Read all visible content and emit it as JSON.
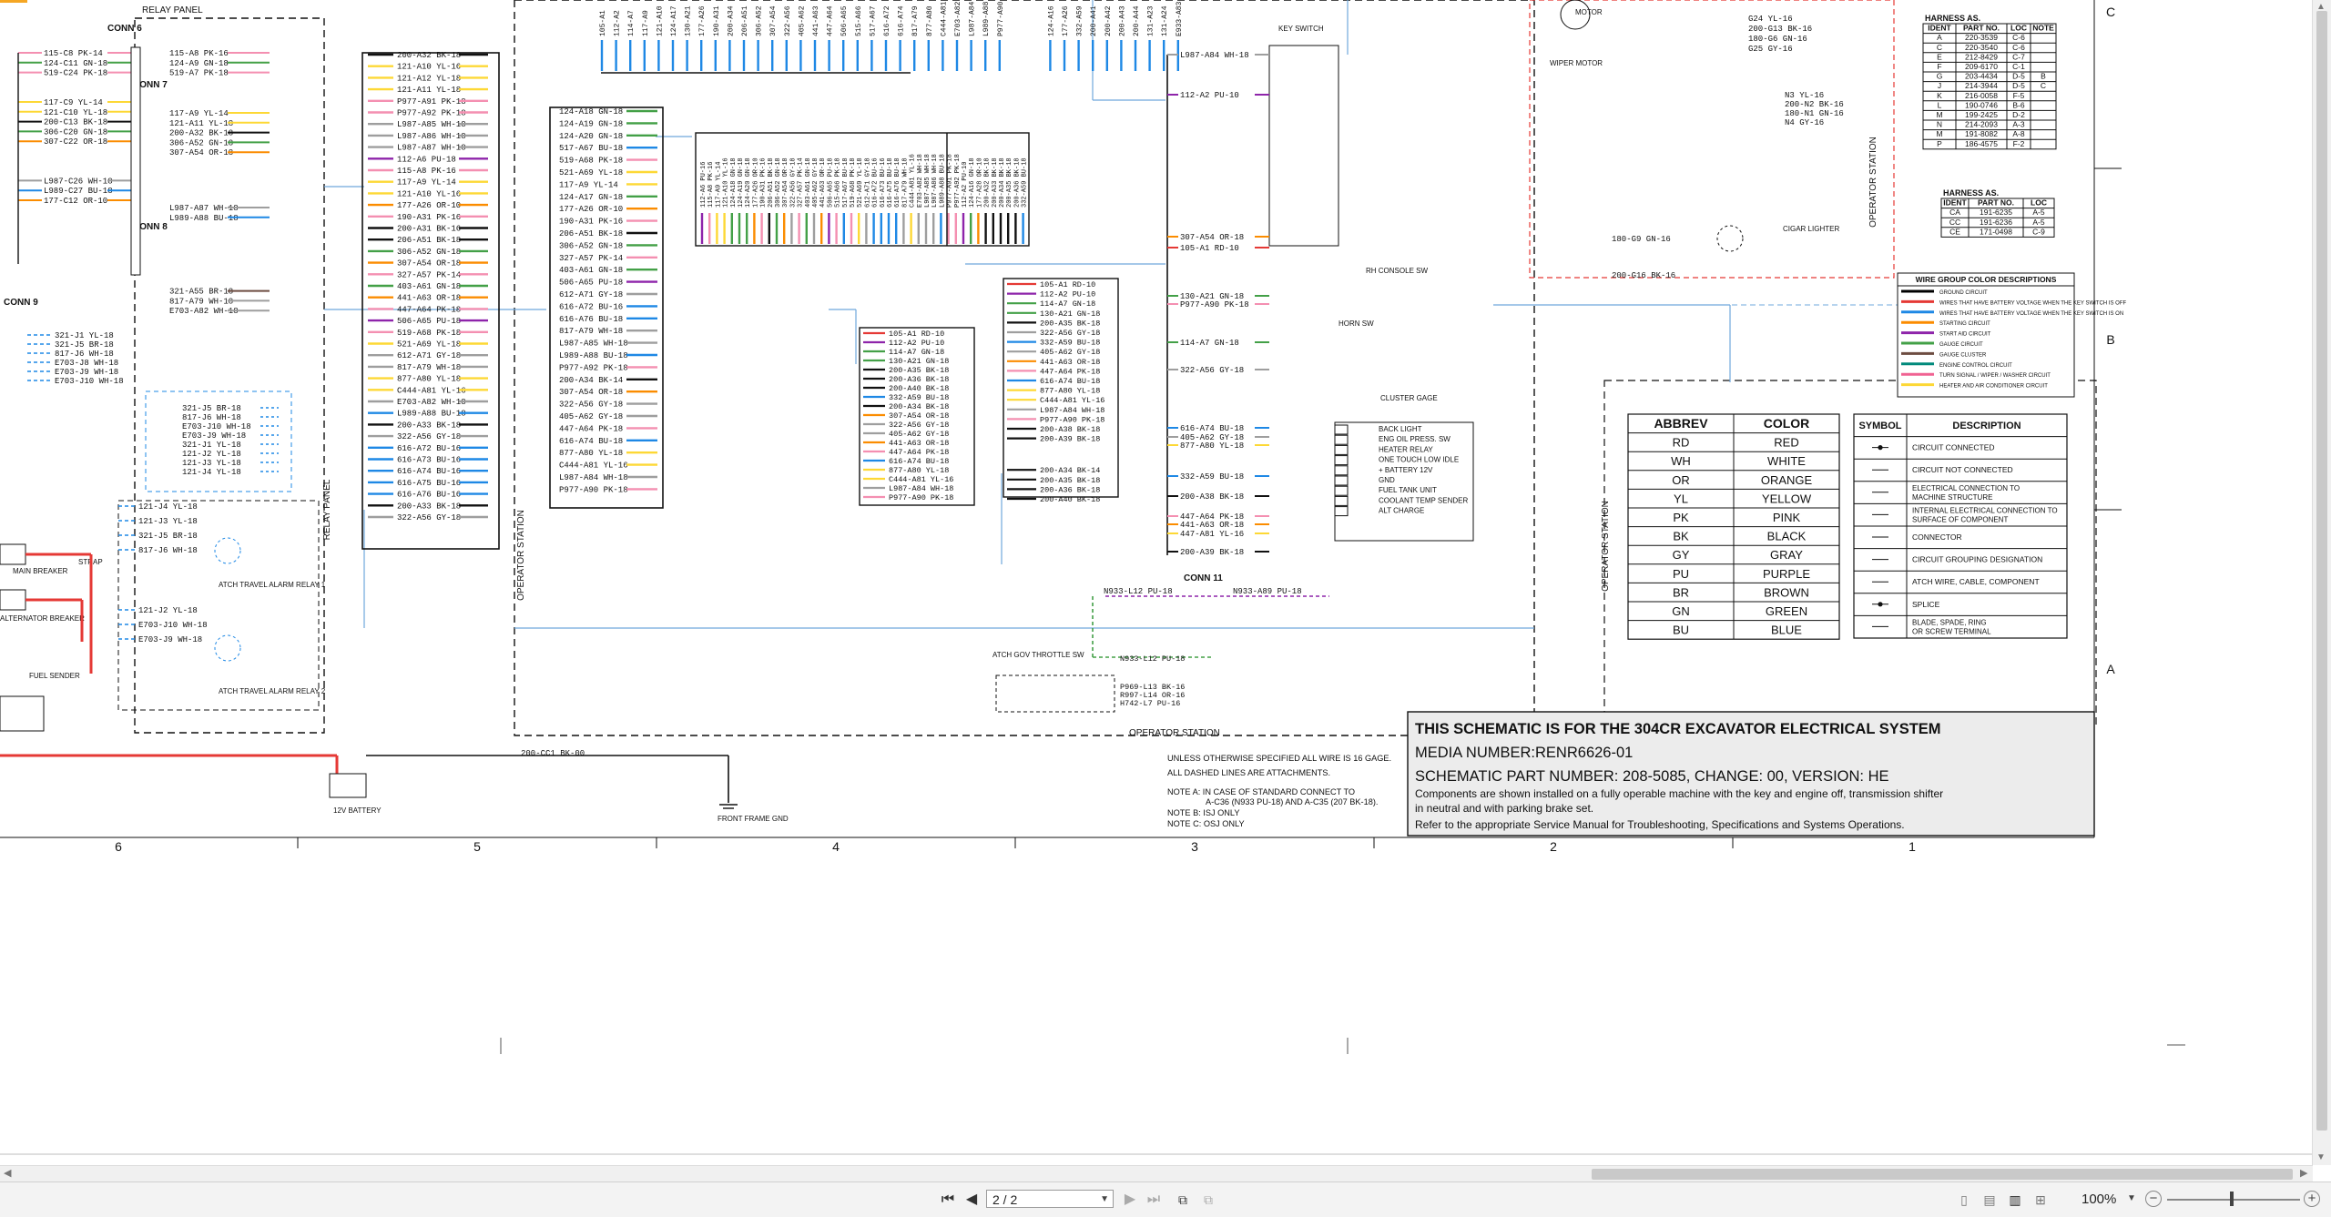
{
  "document": {
    "top_tab": "RELAY PANEL",
    "relay_panel_label": "RELAY PANEL",
    "operator_station_label": "OPERATOR STATION",
    "conn_labels": [
      "CONN 6",
      "CONN 7",
      "CONN 8",
      "CONN 9",
      "CONN 11"
    ],
    "key_switch_label": "KEY SWITCH",
    "front_frame_gnd": "FRONT FRAME GND",
    "battery_label": "12V BATTERY",
    "fuel_sender_label": "FUEL SENDER",
    "main_breaker_label": "MAIN BREAKER",
    "alternator_breaker_label": "ALTERNATOR BREAKER",
    "strap_label": "STRAP",
    "atch_relay_1": "ATCH TRAVEL ALARM RELAY 1",
    "atch_relay_2": "ATCH TRAVEL ALARM RELAY 2",
    "wiper_motor_label": "WIPER MOTOR",
    "cigar_lighter_label": "CIGAR LIGHTER",
    "rh_console_label": "RH CONSOLE SW",
    "horn_label": "HORN SW",
    "cluster_gauge_label": "CLUSTER GAGE",
    "throttle_label": "ATCH GOV THROTTLE SW",
    "ground_wire": "200-CC1 BK-00",
    "cluster_items": [
      "BACK LIGHT",
      "ENG OIL PRESS. SW",
      "HEATER RELAY",
      "ONE TOUCH LOW IDLE",
      "+ BATTERY 12V",
      "GND",
      "FUEL TANK UNIT",
      "COOLANT TEMP SENDER",
      "ALT CHARGE"
    ],
    "conn6_wires_left": [
      "115-C8 PK-14",
      "124-C11 GN-18",
      "519-C24 PK-18"
    ],
    "conn6_wires_right": [
      "115-A8 PK-16",
      "124-A9 GN-18",
      "519-A7 PK-18"
    ],
    "conn7_wires_left": [
      "117-C9 YL-14",
      "121-C10 YL-18",
      "200-C13 BK-18",
      "306-C20 GN-18",
      "307-C22 OR-18"
    ],
    "conn7_wires_right": [
      "117-A9 YL-14",
      "121-A11 YL-18",
      "200-A32 BK-18",
      "306-A52 GN-18",
      "307-A54 OR-18"
    ],
    "relay_block_wires": [
      "200-A32 BK-18",
      "121-A10 YL-16",
      "121-A12 YL-18",
      "121-A11 YL-18",
      "P977-A91 PK-18",
      "P977-A92 PK-18",
      "L987-A85 WH-18",
      "L987-A86 WH-18",
      "L987-A87 WH-18",
      "112-A6 PU-18",
      "115-A8 PK-16",
      "117-A9 YL-14",
      "121-A10 YL-16",
      "177-A26 OR-10",
      "190-A31 PK-16",
      "200-A31 BK-16",
      "206-A51 BK-18",
      "306-A52 GN-18",
      "307-A54 OR-18",
      "327-A57 PK-14",
      "403-A61 GN-18",
      "441-A63 OR-18",
      "447-A64 PK-18",
      "506-A65 PU-18",
      "519-A68 PK-18",
      "521-A69 YL-18",
      "612-A71 GY-18",
      "817-A79 WH-18",
      "877-A80 YL-18",
      "C444-A81 YL-16",
      "E703-A82 WH-18",
      "L989-A88 BU-18",
      "200-A33 BK-18",
      "322-A56 GY-18",
      "616-A72 BU-16",
      "616-A73 BU-16",
      "616-A74 BU-16",
      "616-A75 BU-16",
      "616-A76 BU-16",
      "200-A33 BK-18",
      "322-A56 GY-18"
    ],
    "center_block_wires": [
      "124-A18 GN-18",
      "124-A19 GN-18",
      "124-A20 GN-18",
      "517-A67 BU-18",
      "519-A68 PK-18",
      "521-A69 YL-18",
      "117-A9 YL-14",
      "124-A17 GN-18",
      "177-A26 OR-10",
      "190-A31 PK-16",
      "206-A51 BK-18",
      "306-A52 GN-18",
      "327-A57 PK-14",
      "403-A61 GN-18",
      "506-A65 PU-18",
      "612-A71 GY-18",
      "616-A72 BU-16",
      "616-A76 BU-18",
      "817-A79 WH-18",
      "L987-A85 WH-18",
      "L989-A88 BU-18",
      "P977-A92 PK-18",
      "200-A34 BK-14",
      "307-A54 OR-18",
      "322-A56 GY-18",
      "405-A62 GY-18",
      "447-A64 PK-18",
      "616-A74 BU-18",
      "877-A80 YL-18",
      "C444-A81 YL-16",
      "L987-A84 WH-18",
      "P977-A90 PK-18"
    ],
    "right_block_wires": [
      "105-A1 RD-10",
      "112-A2 PU-10",
      "114-A7 GN-18",
      "130-A21 GN-18",
      "200-A35 BK-18",
      "322-A56 GY-18",
      "332-A59 BU-18",
      "405-A62 GY-18",
      "441-A63 OR-18",
      "447-A64 PK-18",
      "616-A74 BU-18",
      "877-A80 YL-18",
      "C444-A81 YL-16",
      "L987-A84 WH-18",
      "P977-A90 PK-18",
      "200-A38 BK-18",
      "200-A39 BK-18",
      "200-A34 BK-14",
      "200-A35 BK-18",
      "200-A36 BK-18",
      "200-A40 BK-18"
    ],
    "mid_block_wires": [
      "105-A1 RD-10",
      "112-A2 PU-10",
      "114-A7 GN-18",
      "130-A21 GN-18",
      "200-A35 BK-18",
      "200-A36 BK-18",
      "200-A40 BK-18",
      "332-A59 BU-18",
      "200-A34 BK-18",
      "307-A54 OR-18",
      "322-A56 GY-18",
      "405-A62 GY-18",
      "441-A63 OR-18",
      "447-A64 PK-18",
      "616-A74 BU-18",
      "877-A80 YL-18",
      "C444-A81 YL-16",
      "L987-A84 WH-18",
      "P977-A90 PK-18"
    ],
    "key_switch_wires": [
      "L987-A84 WH-18",
      "112-A2 PU-10",
      "307-A54 OR-18",
      "105-A1 RD-10",
      "130-A21 GN-18",
      "P977-A90 PK-18",
      "114-A7 GN-18",
      "322-A56 GY-18",
      "616-A74 BU-18",
      "405-A62 GY-18",
      "877-A80 YL-18",
      "332-A59 BU-18",
      "200-A38 BK-18",
      "447-A64 PK-18",
      "441-A63 OR-18",
      "447-A81 YL-16",
      "200-A39 BK-18"
    ],
    "conn11_wires": [
      "N933-L12 PU-18",
      "N933-A89 PU-18"
    ],
    "throttle_wires": [
      "N933-L12 PU-18",
      "P969-L13 BK-16",
      "R997-L14 OR-16",
      "H742-L7 PU-16"
    ],
    "conn9_wires": [
      "321-J1 YL-18",
      "321-J5 BR-18",
      "817-J6 WH-18",
      "E703-J8 WH-18",
      "E703-J9 WH-18",
      "E703-J10 WH-18"
    ],
    "conn9b_wires": [
      "321-J5 BR-18",
      "817-J6 WH-18",
      "E703-J10 WH-18",
      "E703-J9 WH-18",
      "321-J1 YL-18",
      "121-J2 YL-18",
      "121-J3 YL-18",
      "121-J4 YL-18"
    ],
    "alarm_wires": [
      "121-J4 YL-18",
      "121-J3 YL-18",
      "321-J5 BR-18",
      "817-J6 WH-18",
      "121-J2 YL-18",
      "E703-J10 WH-18",
      "E703-J9 WH-18"
    ],
    "conn8_wires": [
      "L987-C26 WH-18",
      "L989-C27 BU-18",
      "177-C12 OR-10"
    ],
    "conn8_right": [
      "L987-A87 WH-18",
      "L989-A88 BU-18",
      "321-A55 BR-18",
      "817-A79 WH-18",
      "E703-A82 WH-18"
    ],
    "wiper_wires": [
      "G24 YL-16",
      "200-G13 BK-16",
      "180-G6 GN-16",
      "G25 GY-16",
      "N3 YL-16",
      "200-N2 BK-16",
      "180-N1 GN-16",
      "N4 GY-16",
      "180-G9 GN-16",
      "200-G16 BK-16"
    ],
    "top_wire_columns": [
      "105-A1",
      "112-A2",
      "114-A7",
      "117-A9",
      "121-A10",
      "124-A17",
      "130-A21",
      "177-A26",
      "190-A31",
      "200-A34",
      "206-A51",
      "306-A52",
      "307-A54",
      "322-A56",
      "405-A62",
      "441-A63",
      "447-A64",
      "506-A65",
      "515-A66",
      "517-A67",
      "616-A72",
      "616-A74",
      "817-A79",
      "877-A80",
      "C444-A81",
      "E703-A82",
      "L987-A84",
      "L989-A88",
      "P977-A90",
      "124-A16",
      "177-A26",
      "332-A59",
      "200-A41",
      "200-A42",
      "200-A43",
      "200-A44",
      "131-A23",
      "131-A24",
      "E933-A83"
    ],
    "center_vertical_wires": [
      "112-A6 PU-16",
      "115-A8 PK-16",
      "117-A9 YL-14",
      "121-A10 YL-16",
      "124-A18 GN-18",
      "124-A19 GN-18",
      "124-A20 GN-18",
      "177-A26 OR-10",
      "190-A31 PK-16",
      "206-A51 BK-18",
      "306-A52 GN-18",
      "307-A54 OR-18",
      "322-A56 GY-18",
      "327-A57 PK-14",
      "403-A61 GN-18",
      "405-A62 GY-18",
      "441-A63 OR-18",
      "506-A65 PU-18",
      "515-A66 PK-18",
      "517-A67 BU-18",
      "519-A68 PK-18",
      "521-A69 YL-18",
      "612-A71 GY-18",
      "616-A72 BU-16",
      "616-A73 BU-16",
      "616-A75 BU-18",
      "616-A76 BU-18",
      "817-A79 WH-18",
      "C444-A81 YL-16",
      "E703-A82 WH-18",
      "L987-A85 WH-18",
      "L987-A86 WH-18",
      "L989-A88 BU-18",
      "P977-A91 PK-18",
      "P977-A92 PK-18",
      "112-A2 PU-10",
      "124-A16 GN-18",
      "177-A28 OR-10",
      "200-A32 BK-18",
      "200-A33 BK-18",
      "200-A34 BK-18",
      "200-A35 BK-18",
      "200-A36 BK-18",
      "332-A59 BU-18"
    ],
    "harness1": {
      "title": "HARNESS AS.",
      "headers": [
        "IDENT",
        "PART NO.",
        "LOC",
        "NOTE"
      ],
      "rows": [
        [
          "A",
          "220-3539",
          "C-6",
          ""
        ],
        [
          "C",
          "220-3540",
          "C-6",
          ""
        ],
        [
          "E",
          "212-8429",
          "C-7",
          ""
        ],
        [
          "F",
          "209-6170",
          "C-1",
          ""
        ],
        [
          "G",
          "203-4434",
          "D-5",
          "B"
        ],
        [
          "J",
          "214-3944",
          "D-5",
          "C"
        ],
        [
          "K",
          "216-0058",
          "F-5",
          ""
        ],
        [
          "L",
          "190-0746",
          "B-6",
          ""
        ],
        [
          "M",
          "199-2425",
          "D-2",
          ""
        ],
        [
          "N",
          "214-2093",
          "A-3",
          ""
        ],
        [
          "M",
          "191-8082",
          "A-8",
          ""
        ],
        [
          "P",
          "186-4575",
          "F-2",
          ""
        ]
      ]
    },
    "harness2": {
      "title": "HARNESS AS.",
      "headers": [
        "IDENT",
        "PART NO.",
        "LOC"
      ],
      "rows": [
        [
          "CA",
          "191-6235",
          "A-5"
        ],
        [
          "CC",
          "191-6236",
          "A-5"
        ],
        [
          "CE",
          "171-0498",
          "C-9"
        ]
      ]
    },
    "wire_group": {
      "title": "WIRE GROUP COLOR DESCRIPTIONS",
      "rows": [
        {
          "color": "#000000",
          "label": "GROUND CIRCUIT"
        },
        {
          "color": "#e53935",
          "label": "WIRES THAT HAVE BATTERY VOLTAGE WHEN THE KEY SWITCH IS OFF"
        },
        {
          "color": "#1e88e5",
          "label": "WIRES THAT HAVE BATTERY VOLTAGE WHEN THE KEY SWITCH IS ON"
        },
        {
          "color": "#fb8c00",
          "label": "STARTING CIRCUIT"
        },
        {
          "color": "#8e24aa",
          "label": "START AID CIRCUIT"
        },
        {
          "color": "#43a047",
          "label": "GAUGE CIRCUIT"
        },
        {
          "color": "#6d4c41",
          "label": "GAUGE CLUSTER"
        },
        {
          "color": "#00897b",
          "label": "ENGINE CONTROL CIRCUIT"
        },
        {
          "color": "#f06292",
          "label": "TURN SIGNAL / WIPER / WASHER CIRCUIT"
        },
        {
          "color": "#fdd835",
          "label": "HEATER AND AIR CONDITIONER CIRCUIT"
        }
      ]
    },
    "color_table": {
      "headers": [
        "ABBREV",
        "COLOR"
      ],
      "rows": [
        [
          "RD",
          "RED"
        ],
        [
          "WH",
          "WHITE"
        ],
        [
          "OR",
          "ORANGE"
        ],
        [
          "YL",
          "YELLOW"
        ],
        [
          "PK",
          "PINK"
        ],
        [
          "BK",
          "BLACK"
        ],
        [
          "GY",
          "GRAY"
        ],
        [
          "PU",
          "PURPLE"
        ],
        [
          "BR",
          "BROWN"
        ],
        [
          "GN",
          "GREEN"
        ],
        [
          "BU",
          "BLUE"
        ]
      ]
    },
    "symbol_table": {
      "headers": [
        "SYMBOL",
        "DESCRIPTION"
      ],
      "rows": [
        "CIRCUIT CONNECTED",
        "CIRCUIT NOT CONNECTED",
        "ELECTRICAL CONNECTION TO MACHINE STRUCTURE",
        "INTERNAL ELECTRICAL CONNECTION TO SURFACE OF COMPONENT",
        "CONNECTOR",
        "CIRCUIT GROUPING DESIGNATION",
        "ATCH WIRE, CABLE, COMPONENT",
        "SPLICE",
        "BLADE, SPADE, RING OR SCREW TERMINAL"
      ]
    },
    "notes": [
      "UNLESS OTHERWISE SPECIFIED ALL WIRE IS 16 GAGE.",
      "ALL DASHED LINES ARE ATTACHMENTS.",
      "NOTE A: IN CASE OF STANDARD CONNECT TO",
      "A-C36 (N933 PU-18) AND A-C35 (207 BK-18).",
      "NOTE B: ISJ ONLY",
      "NOTE C: OSJ ONLY"
    ],
    "title_block": {
      "line1": "THIS SCHEMATIC IS FOR THE 304CR EXCAVATOR ELECTRICAL SYSTEM",
      "line2": "MEDIA NUMBER:RENR6626-01",
      "line3": "SCHEMATIC PART NUMBER: 208-5085, CHANGE: 00, VERSION: HE",
      "line4": "Components are shown installed on a fully operable machine with the key and engine off, transmission shifter",
      "line5": "in neutral and with parking brake set.",
      "line6": "Refer to the appropriate Service Manual for Troubleshooting, Specifications and Systems Operations."
    },
    "grid_numbers": [
      "6",
      "5",
      "4",
      "3",
      "2",
      "1"
    ],
    "grid_letters": [
      "C",
      "B",
      "A"
    ]
  },
  "viewer": {
    "page_indicator": "2 / 2",
    "zoom": "100%",
    "icons": [
      "first-page-icon",
      "prev-page-icon",
      "next-page-icon",
      "last-page-icon"
    ]
  }
}
